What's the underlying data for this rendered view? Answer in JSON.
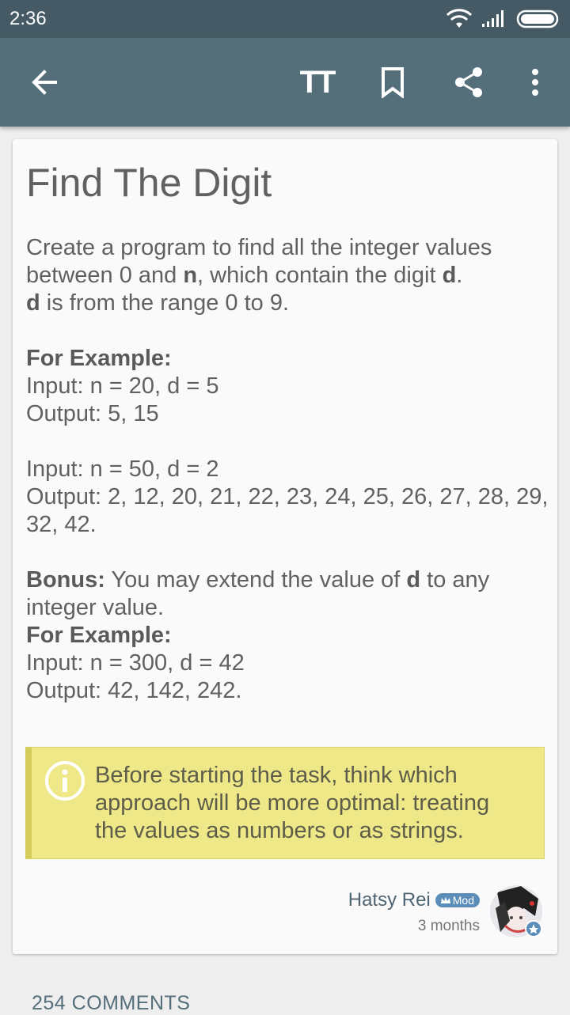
{
  "status_bar": {
    "time": "2:36"
  },
  "toolbar": {
    "text_size_icon": "TT"
  },
  "lesson": {
    "title": "Find The Digit",
    "intro_line1": "Create a program to find all the integer values",
    "intro_line2_a": "between 0 and ",
    "intro_line2_b": "n",
    "intro_line2_c": ", which contain the digit ",
    "intro_line2_d": "d",
    "intro_line2_e": ".",
    "intro_line3_a": "d",
    "intro_line3_b": " is from the range 0 to 9.",
    "example_heading": "For Example:",
    "ex1_input": "Input: n = 20, d = 5",
    "ex1_output": "Output: 5, 15",
    "ex2_input": "Input: n = 50, d = 2",
    "ex2_output_line1": "Output: 2, 12, 20, 21, 22, 23, 24, 25, 26, 27, 28, 29,",
    "ex2_output_line2": "32, 42.",
    "bonus_label": "Bonus:",
    "bonus_text_a": " You may extend the value of ",
    "bonus_text_b": "d",
    "bonus_text_c": " to any",
    "bonus_text_line2": "integer value.",
    "example_heading2": "For Example:",
    "ex3_input": "Input: n = 300, d = 42",
    "ex3_output": "Output: 42, 142, 242.",
    "note_line1": "Before starting the task, think which",
    "note_line2": "approach will be more optimal: treating",
    "note_line3": "the values as numbers or as strings."
  },
  "author": {
    "name": "Hatsy Rei",
    "badge": "Mod",
    "time": "3 months"
  },
  "comments": {
    "label": "254 COMMENTS"
  },
  "colors": {
    "status_bar": "#455a64",
    "toolbar": "#546e7a",
    "note_bg": "#eee888",
    "badge": "#5c8db8"
  }
}
